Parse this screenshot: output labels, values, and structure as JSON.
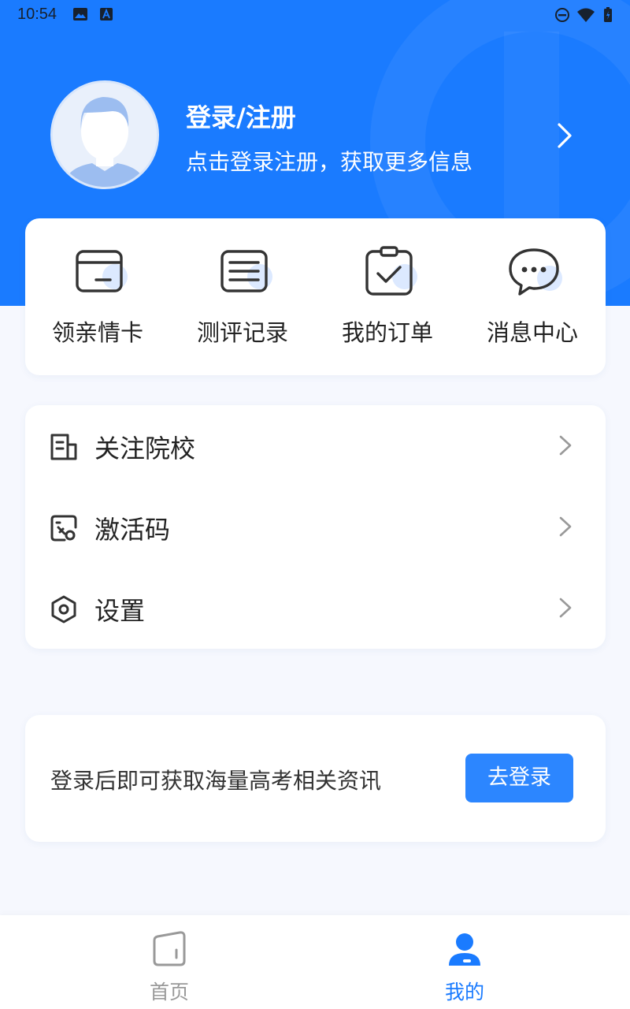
{
  "status_bar": {
    "time": "10:54"
  },
  "profile": {
    "title": "登录/注册",
    "subtitle": "点击登录注册，获取更多信息"
  },
  "quick_actions": [
    {
      "label": "领亲情卡",
      "icon": "card-icon"
    },
    {
      "label": "测评记录",
      "icon": "list-icon"
    },
    {
      "label": "我的订单",
      "icon": "clipboard-check-icon"
    },
    {
      "label": "消息中心",
      "icon": "chat-bubble-icon"
    }
  ],
  "menu": [
    {
      "label": "关注院校",
      "icon": "building-icon"
    },
    {
      "label": "激活码",
      "icon": "activation-code-icon"
    },
    {
      "label": "设置",
      "icon": "settings-hexagon-icon"
    }
  ],
  "promo": {
    "text": "登录后即可获取海量高考相关资讯",
    "button": "去登录"
  },
  "tabs": [
    {
      "label": "首页",
      "icon": "home-icon",
      "active": false
    },
    {
      "label": "我的",
      "icon": "user-icon",
      "active": true
    }
  ],
  "colors": {
    "accent": "#1a7bff",
    "button": "#2c86ff",
    "tab_inactive": "#999999"
  }
}
